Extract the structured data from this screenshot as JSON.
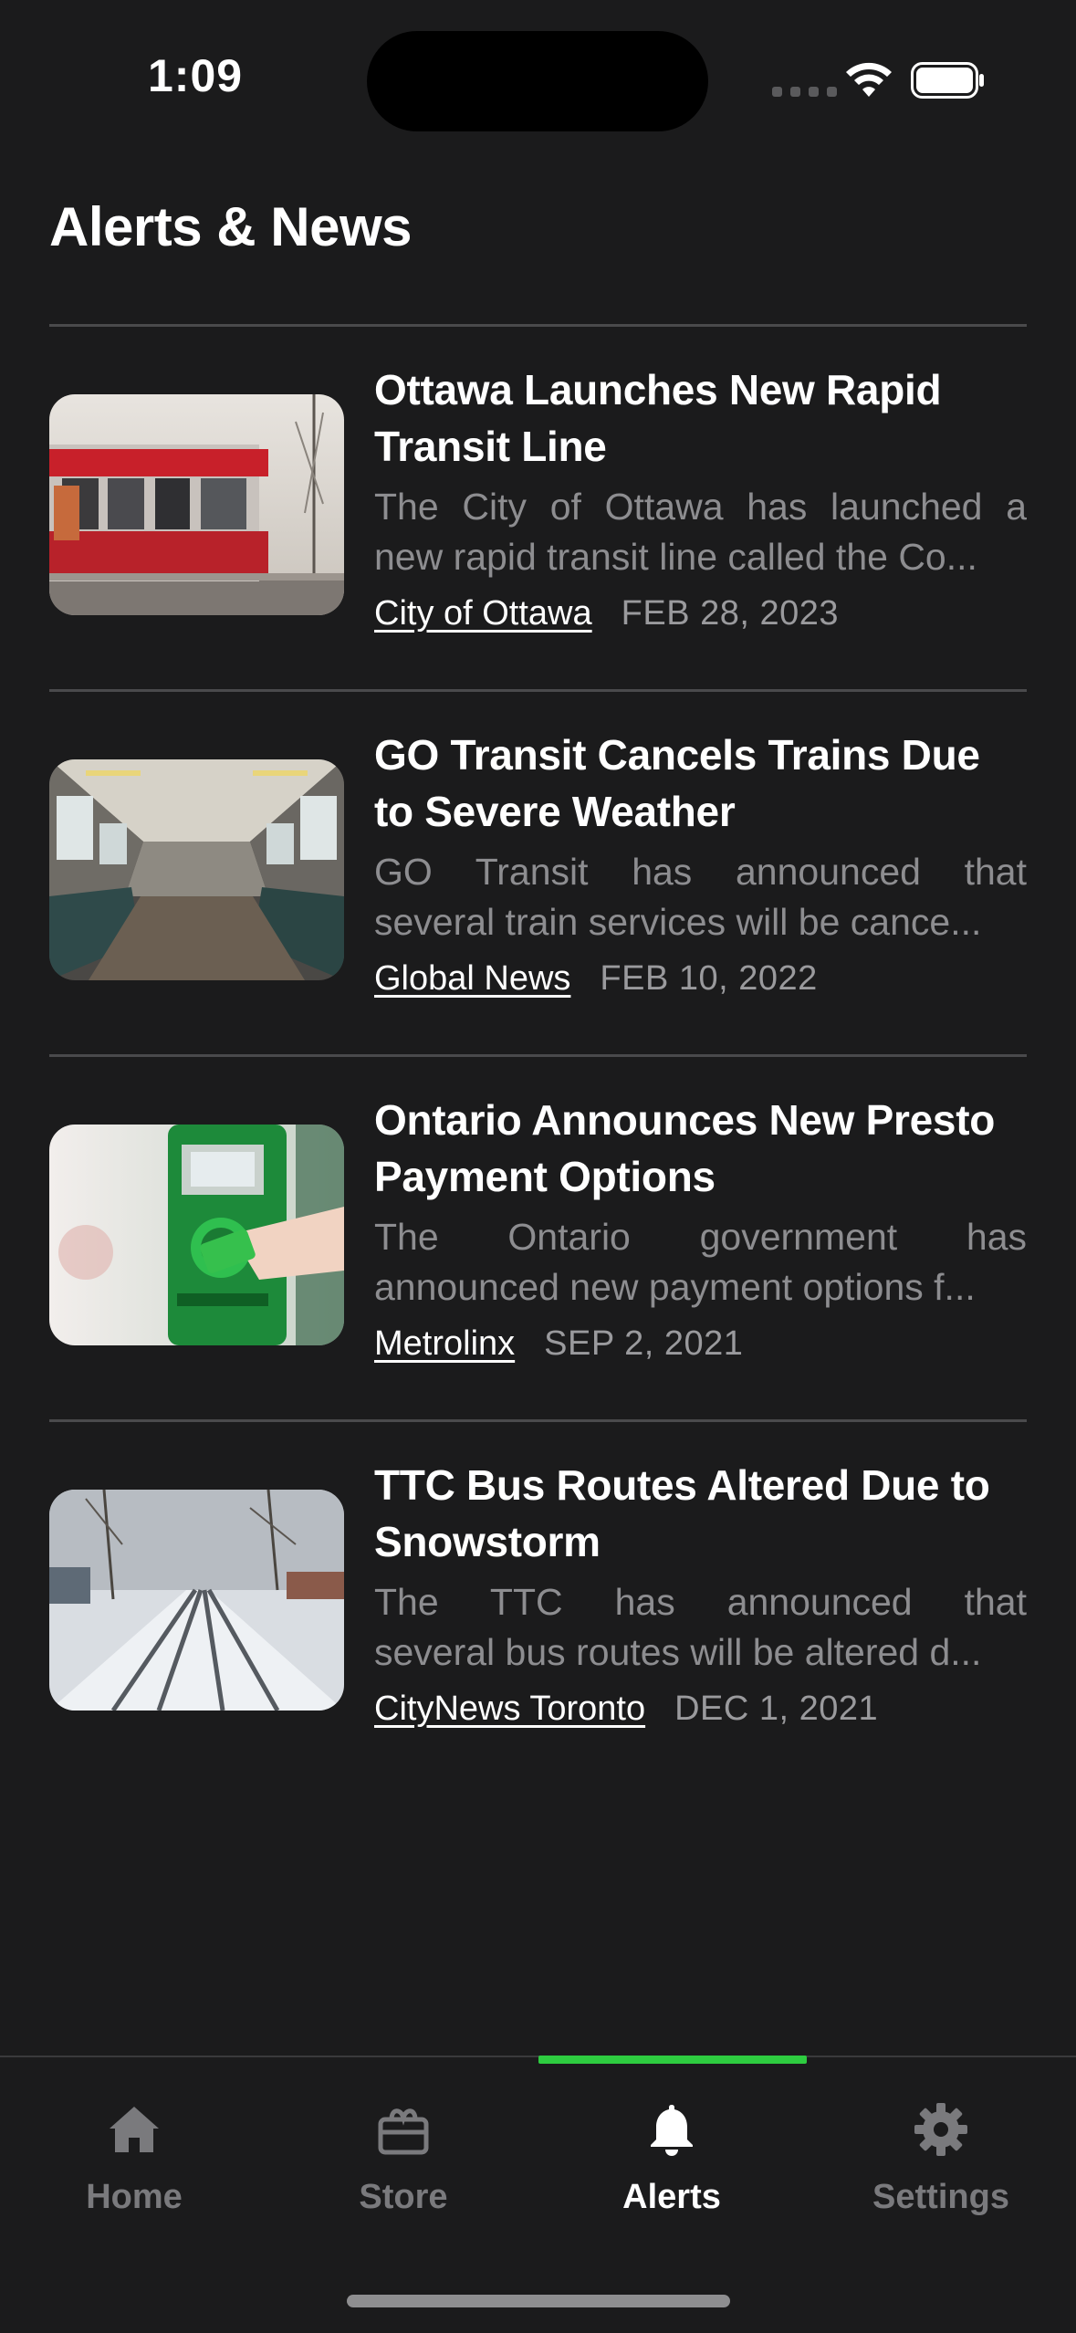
{
  "status_bar": {
    "time": "1:09"
  },
  "page": {
    "title": "Alerts & News"
  },
  "news": [
    {
      "title": "Ottawa Launches New Rapid Transit Line",
      "summary_line1": "The City of Ottawa has launched a",
      "summary_line2": "new rapid transit line called the Co...",
      "source": "City of Ottawa",
      "date": "FEB 28, 2023",
      "image": "streetcar-photo"
    },
    {
      "title": "GO Transit Cancels Trains Due to Severe Weather",
      "summary_line1": "GO Transit has announced that",
      "summary_line2": "several train services will be cance...",
      "source": "Global News",
      "date": "FEB 10, 2022",
      "image": "train-interior-photo"
    },
    {
      "title": "Ontario Announces New Presto Payment Options",
      "summary_line1": "The Ontario government has",
      "summary_line2": "announced new payment options f...",
      "source": "Metrolinx",
      "date": "SEP 2, 2021",
      "image": "presto-reader-photo"
    },
    {
      "title": "TTC Bus Routes Altered Due to Snowstorm",
      "summary_line1": "The TTC has announced that",
      "summary_line2": "several bus routes will be altered d...",
      "source": "CityNews Toronto",
      "date": "DEC 1, 2021",
      "image": "snowy-street-photo"
    }
  ],
  "tab_bar": {
    "tabs": [
      {
        "label": "Home",
        "icon": "home-icon",
        "active": false
      },
      {
        "label": "Store",
        "icon": "store-icon",
        "active": false
      },
      {
        "label": "Alerts",
        "icon": "bell-icon",
        "active": true
      },
      {
        "label": "Settings",
        "icon": "gear-icon",
        "active": false
      }
    ],
    "active_color": "#2ecc40"
  },
  "colors": {
    "background": "#1b1b1c",
    "divider": "#4a4a4c",
    "summary_text": "#8d8d90",
    "inactive_tab": "#7a7a7d"
  }
}
